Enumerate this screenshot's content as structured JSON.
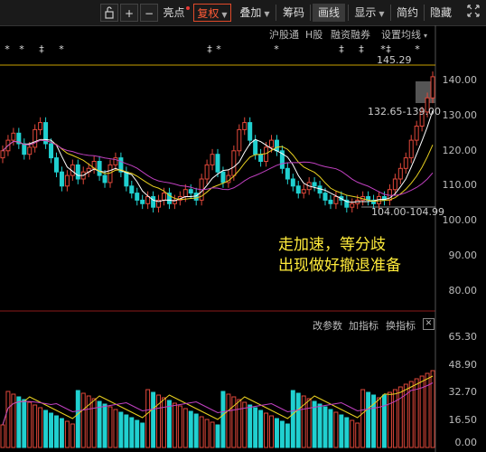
{
  "toolbar": {
    "lock_icon": "lock-icon",
    "plus": "+",
    "minus": "−",
    "liangdian": "亮点",
    "fuquan": "复权",
    "diejia": "叠加",
    "chouma": "筹码",
    "huaxian": "画线",
    "xianshi": "显示",
    "jianyue": "简约",
    "yincang": "隐藏"
  },
  "subbar": {
    "hugutong": "沪股通",
    "h_gu": "H股",
    "rongzi": "融资融券",
    "junxian": "设置均线"
  },
  "price_axis": [
    "140.00",
    "130.00",
    "120.00",
    "110.00",
    "100.00",
    "90.00",
    "80.00"
  ],
  "annotations": {
    "top_price": "145.29",
    "range_high": "132.65-139.00",
    "range_low": "104.00-104.99"
  },
  "overlay_text": {
    "line1": "走加速，等分歧",
    "line2": "出现做好撤退准备"
  },
  "volume_panel": {
    "gai_canshu": "改参数",
    "jia_zhibiao": "加指标",
    "huan_zhibiao": "换指标",
    "axis": [
      "65.30",
      "48.90",
      "32.70",
      "16.50",
      "0.00"
    ]
  },
  "colors": {
    "up": "#e0483a",
    "down": "#20d0d0",
    "ma5": "#ffffff",
    "ma10": "#e8d020",
    "ma20": "#c040c0",
    "text_yellow": "#ffeb3b"
  }
}
